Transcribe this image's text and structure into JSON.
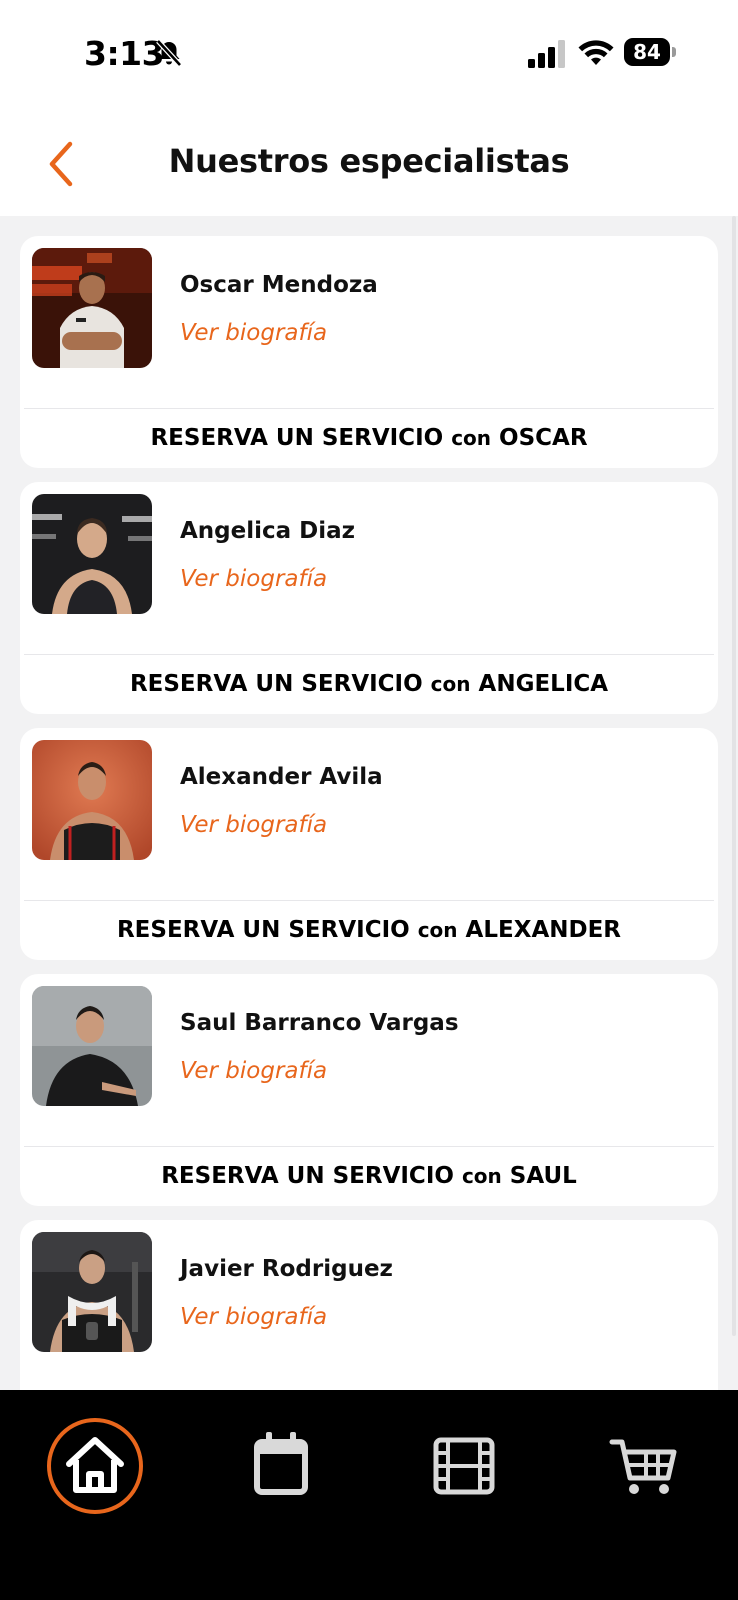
{
  "status_bar": {
    "time": "3:13",
    "battery": "84"
  },
  "header": {
    "title": "Nuestros especialistas"
  },
  "specialists": [
    {
      "name": "Oscar Mendoza",
      "bio_link": "Ver biografía",
      "reserve_prefix": "RESERVA UN SERVICIO ",
      "reserve_con": "con",
      "reserve_name": " OSCAR"
    },
    {
      "name": "Angelica Diaz",
      "bio_link": "Ver biografía",
      "reserve_prefix": "RESERVA UN SERVICIO ",
      "reserve_con": "con",
      "reserve_name": " ANGELICA"
    },
    {
      "name": "Alexander Avila",
      "bio_link": "Ver biografía",
      "reserve_prefix": "RESERVA UN SERVICIO ",
      "reserve_con": "con",
      "reserve_name": " ALEXANDER"
    },
    {
      "name": "Saul Barranco Vargas",
      "bio_link": "Ver biografía",
      "reserve_prefix": "RESERVA UN SERVICIO ",
      "reserve_con": "con",
      "reserve_name": " SAUL"
    },
    {
      "name": "Javier Rodriguez",
      "bio_link": "Ver biografía"
    }
  ],
  "bottom_nav": {
    "items": [
      "home-icon",
      "calendar-icon",
      "film-icon",
      "cart-icon"
    ],
    "active": "home-icon"
  },
  "colors": {
    "accent": "#e8661c",
    "background": "#f2f2f3",
    "card": "#ffffff",
    "nav_background": "#000000"
  }
}
